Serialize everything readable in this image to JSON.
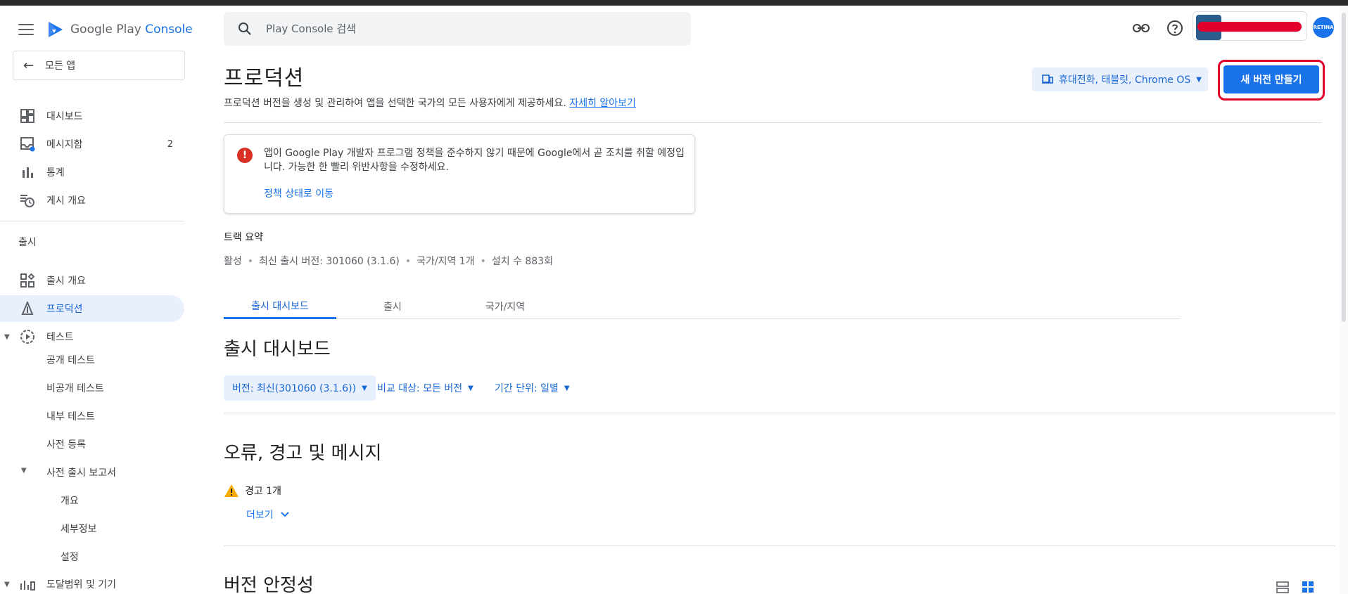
{
  "brand": {
    "name_prefix": "Google Play ",
    "name_suffix": "Console"
  },
  "sidebar": {
    "all_apps": "모든 앱",
    "items_top": [
      {
        "label": "대시보드",
        "icon": "dashboard-icon"
      },
      {
        "label": "메시지함",
        "icon": "inbox-icon",
        "count": "2"
      },
      {
        "label": "통계",
        "icon": "bar-chart-icon"
      },
      {
        "label": "게시 개요",
        "icon": "publishing-overview-icon"
      }
    ],
    "section_release": "출시",
    "items_release": [
      {
        "label": "출시 개요",
        "icon": "release-overview-icon"
      },
      {
        "label": "프로덕션",
        "icon": "production-icon",
        "active": true
      },
      {
        "label": "테스트",
        "icon": "testing-icon"
      }
    ],
    "testing_sub": [
      "공개 테스트",
      "비공개 테스트",
      "내부 테스트",
      "사전 등록"
    ],
    "prelaunch": "사전 출시 보고서",
    "prelaunch_sub": [
      "개요",
      "세부정보",
      "설정"
    ],
    "reach": "도달범위 및 기기"
  },
  "header": {
    "search_placeholder": "Play Console 검색",
    "profile_text": "RETINA"
  },
  "main": {
    "title": "프로덕션",
    "description": "프로덕션 버전을 생성 및 관리하여 앱을 선택한 국가의 모든 사용자에게 제공하세요.",
    "learn_more": "자세히 알아보기",
    "device_filter": "휴대전화, 태블릿, Chrome OS",
    "create_button": "새 버전 만들기",
    "alert": {
      "text": "앱이 Google Play 개발자 프로그램 정책을 준수하지 않기 때문에 Google에서 곧 조치를 취할 예정입니다. 가능한 한 빨리 위반사항을 수정하세요.",
      "link": "정책 상태로 이동"
    },
    "track_summary": "트랙 요약",
    "track_meta": [
      "활성",
      "최신 출시 버전: 301060 (3.1.6)",
      "국가/지역 1개",
      "설치 수 883회"
    ],
    "tabs": [
      "출시 대시보드",
      "출시",
      "국가/지역"
    ],
    "dashboard_title": "출시 대시보드",
    "filters": {
      "version": "버전: 최신(301060 (3.1.6))",
      "compare": "비교 대상: 모든 버전",
      "period": "기간 단위: 일별"
    },
    "errors_title": "오류, 경고 및 메시지",
    "warning": "경고 1개",
    "more": "더보기",
    "stability_title": "버전 안정성"
  },
  "colors": {
    "accent": "#1a73e8",
    "highlight_outline": "#e0002a",
    "error": "#d93025",
    "warning": "#f9ab00"
  }
}
